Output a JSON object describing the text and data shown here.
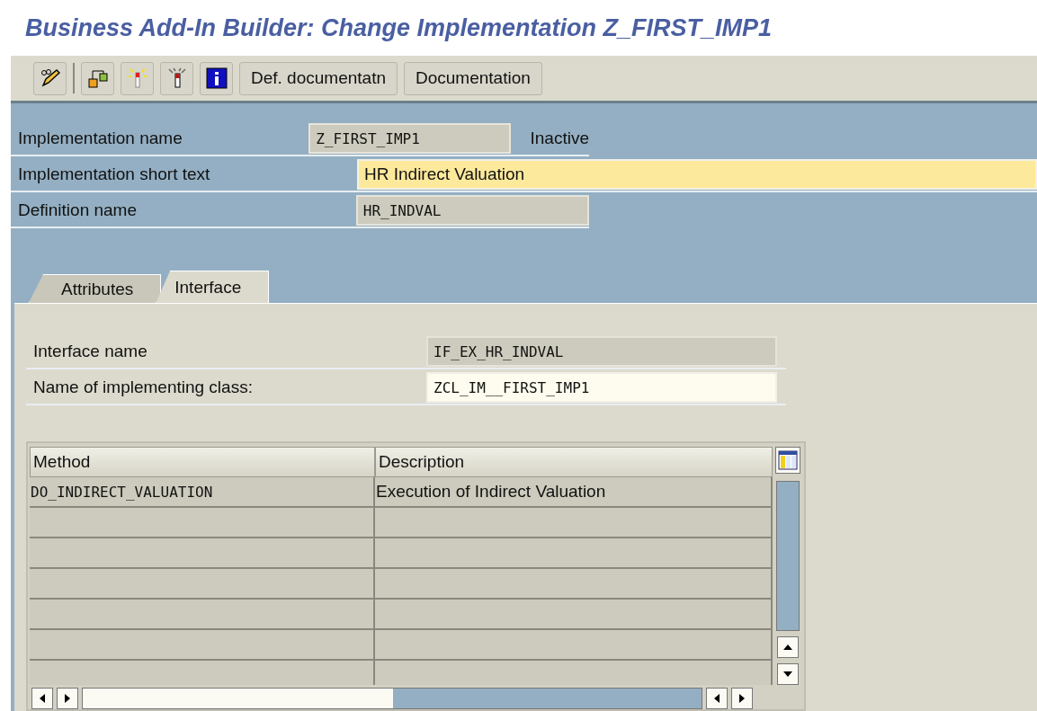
{
  "window": {
    "title": "Business Add-In Builder: Change Implementation Z_FIRST_IMP1"
  },
  "toolbar": {
    "icons": [
      {
        "kind": "pencil"
      },
      {
        "kind": "separator"
      },
      {
        "kind": "hierarchy"
      },
      {
        "kind": "activate"
      },
      {
        "kind": "deactivate"
      },
      {
        "kind": "info"
      }
    ],
    "buttons": [
      "Def. documentatn",
      "Documentation"
    ]
  },
  "header_fields": [
    {
      "label": "Implementation name",
      "value": "Z_FIRST_IMP1",
      "kind": "display",
      "status": "Inactive"
    },
    {
      "label": "Implementation short text",
      "value": "HR Indirect Valuation",
      "kind": "required"
    },
    {
      "label": "Definition name",
      "value": "HR_INDVAL",
      "kind": "display"
    }
  ],
  "tabs": [
    {
      "label": "Attributes",
      "selected": false
    },
    {
      "label": "Interface",
      "selected": true
    }
  ],
  "interface_fields": [
    {
      "label": "Interface name",
      "value": "IF_EX_HR_INDVAL",
      "kind": "display"
    },
    {
      "label": "Name of implementing class:",
      "value": "ZCL_IM__FIRST_IMP1",
      "kind": "input"
    }
  ],
  "table": {
    "columns": [
      "Method",
      "Description"
    ],
    "rows": [
      {
        "method": "DO_INDIRECT_VALUATION",
        "description": "Execution of Indirect Valuation"
      }
    ]
  }
}
